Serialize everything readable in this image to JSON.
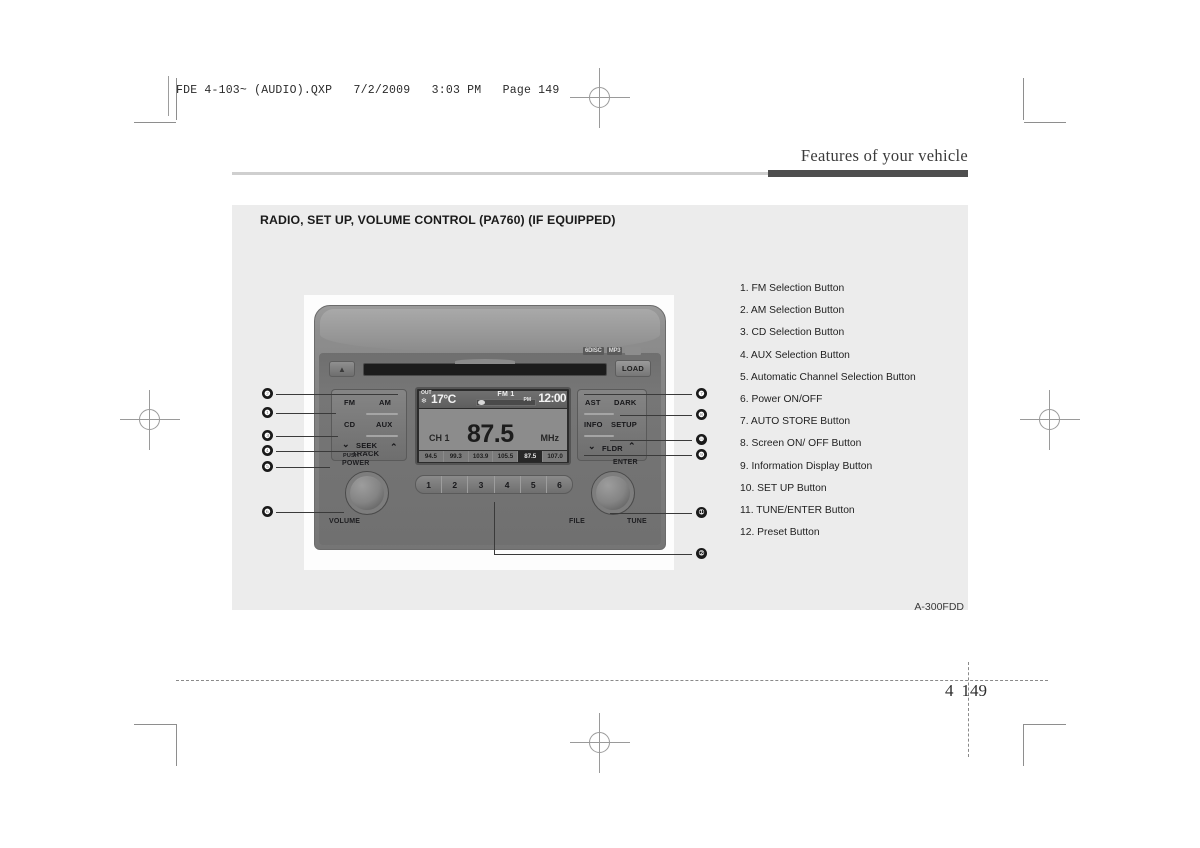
{
  "page": {
    "file_stamp": "FDE 4-103~ (AUDIO).QXP   7/2/2009   3:03 PM   Page 149",
    "chapter_title": "Features of your vehicle",
    "page_number_chapter": "4",
    "page_number": "149"
  },
  "figure": {
    "title": "RADIO, SET UP, VOLUME CONTROL (PA760) (IF EQUIPPED)",
    "code": "A-300FDD"
  },
  "callouts": [
    {
      "num": "1",
      "marker": "❶",
      "label": "1. FM Selection Button"
    },
    {
      "num": "2",
      "marker": "❷",
      "label": "2. AM Selection Button"
    },
    {
      "num": "3",
      "marker": "❸",
      "label": "3. CD Selection Button"
    },
    {
      "num": "4",
      "marker": "❹",
      "label": "4. AUX Selection Button"
    },
    {
      "num": "5",
      "marker": "❺",
      "label": "5. Automatic Channel Selection Button"
    },
    {
      "num": "6",
      "marker": "❻",
      "label": "6. Power ON/OFF"
    },
    {
      "num": "7",
      "marker": "❼",
      "label": "7. AUTO STORE Button"
    },
    {
      "num": "8",
      "marker": "❽",
      "label": "8. Screen ON/ OFF Button"
    },
    {
      "num": "9",
      "marker": "❾",
      "label": "9. Information Display Button"
    },
    {
      "num": "10",
      "marker": "❿",
      "label": "10. SET UP Button"
    },
    {
      "num": "11",
      "marker": "➀",
      "label": "11. TUNE/ENTER Button"
    },
    {
      "num": "12",
      "marker": "➁",
      "label": "12. Preset Button"
    }
  ],
  "unit": {
    "eject_icon": "▲",
    "load_label": "LOAD",
    "badges": [
      "6DISC",
      "MP3",
      ""
    ],
    "left_bank": {
      "fm": "FM",
      "am": "AM",
      "cd": "CD",
      "aux": "AUX",
      "seek": "SEEK",
      "track": "TRACK",
      "chev_left": "⌄",
      "chev_right": "⌃"
    },
    "right_bank": {
      "ast": "AST",
      "dark": "DARK",
      "info": "INFO",
      "setup": "SETUP",
      "fldr": "FLDR",
      "chev_left": "⌄",
      "chev_right": "⌃"
    },
    "volume_knob": {
      "push": "PUSH",
      "power": "POWER",
      "volume": "VOLUME"
    },
    "tune_knob": {
      "enter": "ENTER",
      "file": "FILE",
      "tune": "TUNE"
    },
    "preset_keys": [
      "1",
      "2",
      "3",
      "4",
      "5",
      "6"
    ]
  },
  "display": {
    "out_label": "OUT",
    "snow_icon": "❄",
    "temperature": "17°C",
    "band": "FM 1",
    "meridiem": "PM",
    "clock": "12:00",
    "channel": "CH 1",
    "frequency": "87.5",
    "unit": "MHz",
    "presets": [
      {
        "value": "94.5",
        "selected": false
      },
      {
        "value": "99.3",
        "selected": false
      },
      {
        "value": "103.9",
        "selected": false
      },
      {
        "value": "105.5",
        "selected": false
      },
      {
        "value": "87.5",
        "selected": true
      },
      {
        "value": "107.0",
        "selected": false
      }
    ]
  }
}
